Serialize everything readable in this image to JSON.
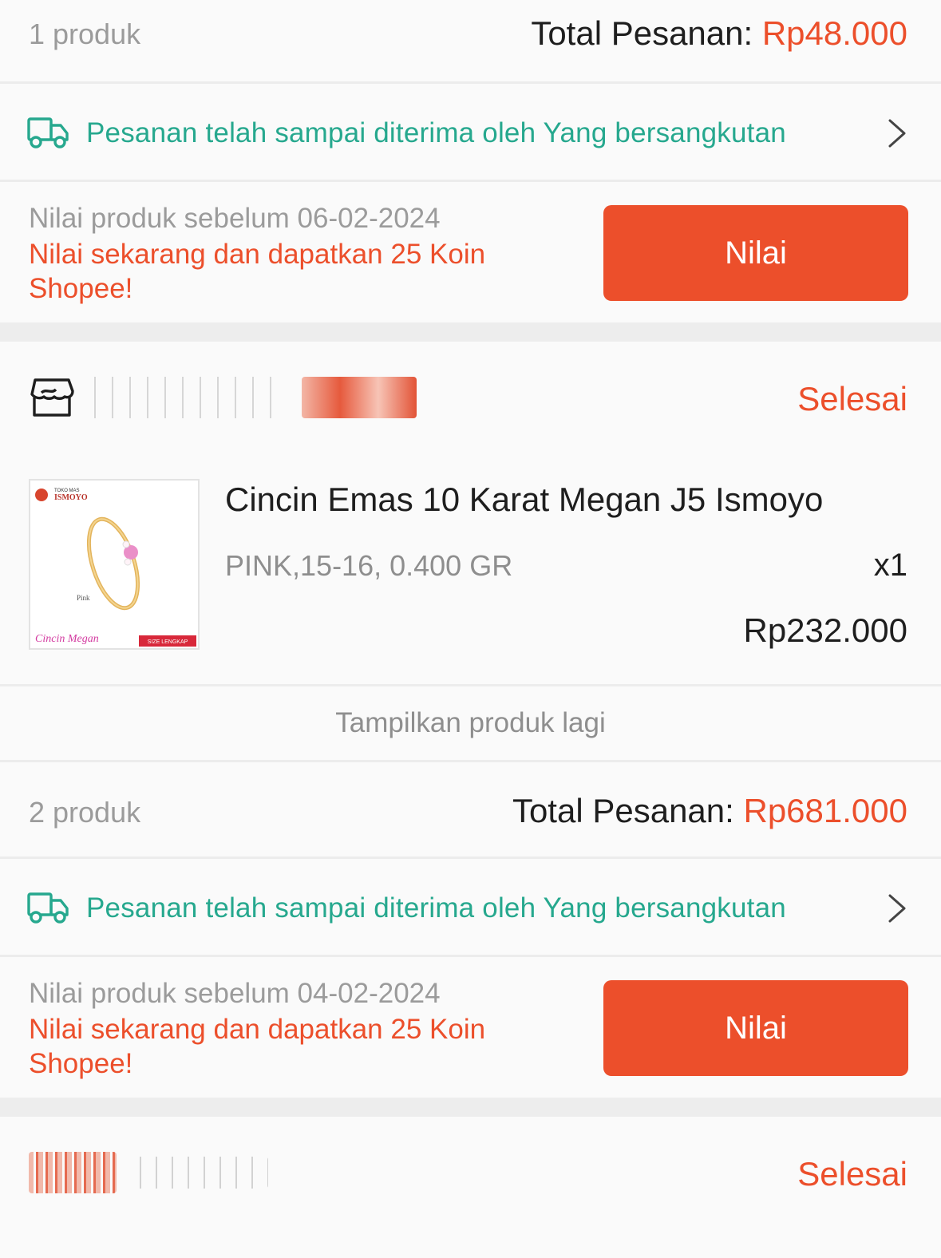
{
  "orders": [
    {
      "summary": {
        "count": "1 produk",
        "total_label": "Total Pesanan: ",
        "total_amount": "Rp48.000"
      },
      "shipping": {
        "text": "Pesanan telah sampai diterima oleh Yang bersangkutan"
      },
      "rating": {
        "deadline": "Nilai produk sebelum 06-02-2024",
        "promo": "Nilai sekarang dan dapatkan 25 Koin Shopee!",
        "button_label": "Nilai"
      }
    },
    {
      "shop": {
        "status": "Selesai"
      },
      "product": {
        "title": "Cincin Emas 10 Karat Megan J5 Ismoyo",
        "variant": "PINK,15-16, 0.400 GR",
        "qty": "x1",
        "price": "Rp232.000",
        "thumb": {
          "brand_top": "TOKO MAS",
          "brand": "ISMOYO",
          "color_label": "Pink",
          "script": "Cincin Megan",
          "badge": "SIZE LENGKAP"
        }
      },
      "show_more": "Tampilkan produk lagi",
      "summary": {
        "count": "2 produk",
        "total_label": "Total Pesanan: ",
        "total_amount": "Rp681.000"
      },
      "shipping": {
        "text": "Pesanan telah sampai diterima oleh Yang bersangkutan"
      },
      "rating": {
        "deadline": "Nilai produk sebelum 04-02-2024",
        "promo": "Nilai sekarang dan dapatkan 25 Koin Shopee!",
        "button_label": "Nilai"
      }
    },
    {
      "shop": {
        "status": "Selesai"
      }
    }
  ],
  "colors": {
    "accent": "#ec4f2b",
    "shipping": "#26a88e",
    "muted": "#9b9b9b",
    "text": "#1e1e1e"
  },
  "icons": {
    "shipping": "truck-icon",
    "chevron": "chevron-right-icon",
    "shop": "store-icon"
  }
}
